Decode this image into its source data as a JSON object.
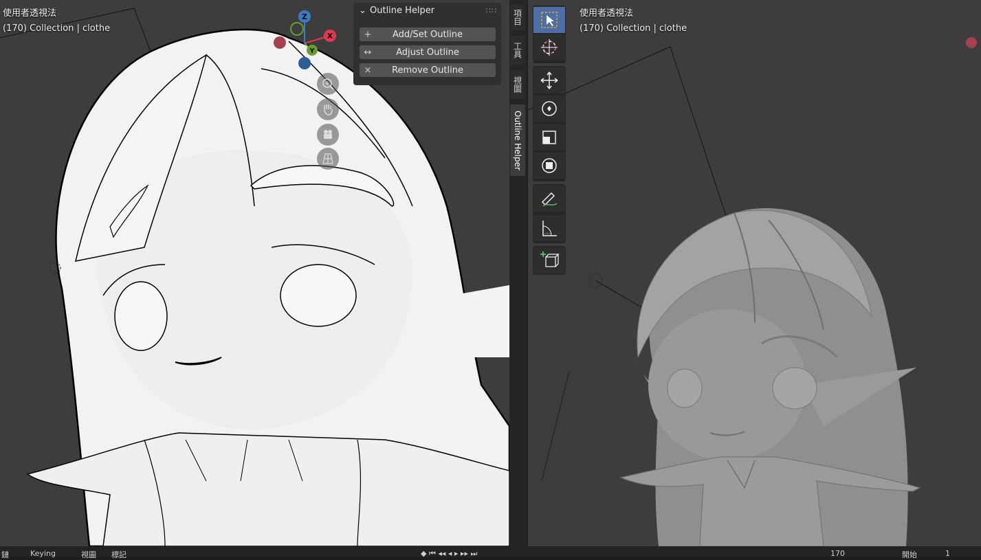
{
  "viewport_left": {
    "view_name": "使用者透視法",
    "collection_info": "(170) Collection | clothe",
    "gizmo": {
      "x": "X",
      "y": "Y",
      "z": "Z"
    }
  },
  "viewport_right": {
    "view_name": "使用者透視法",
    "collection_info": "(170) Collection | clothe"
  },
  "outline_panel": {
    "title": "Outline Helper",
    "buttons": [
      {
        "icon": "+",
        "label": "Add/Set Outline"
      },
      {
        "icon": "↔",
        "label": "Adjust Outline"
      },
      {
        "icon": "×",
        "label": "Remove Outline"
      }
    ]
  },
  "sidebar_tabs": [
    "項目",
    "工具",
    "視圖",
    "Outline Helper"
  ],
  "toolbar": {
    "tools": [
      "select-box",
      "cursor",
      "move",
      "rotate",
      "scale",
      "transform",
      "annotate",
      "measure",
      "add-cube"
    ]
  },
  "status_bar": {
    "items": [
      "鏈",
      "Keying",
      "視圖",
      "標記"
    ],
    "frame": "170",
    "start_label": "開始",
    "start_value": "1"
  },
  "colors": {
    "active_tool": "#4d6fa8",
    "x_axis": "#e2374e",
    "y_axis": "#6a9c2e",
    "z_axis": "#3c7ac7"
  }
}
